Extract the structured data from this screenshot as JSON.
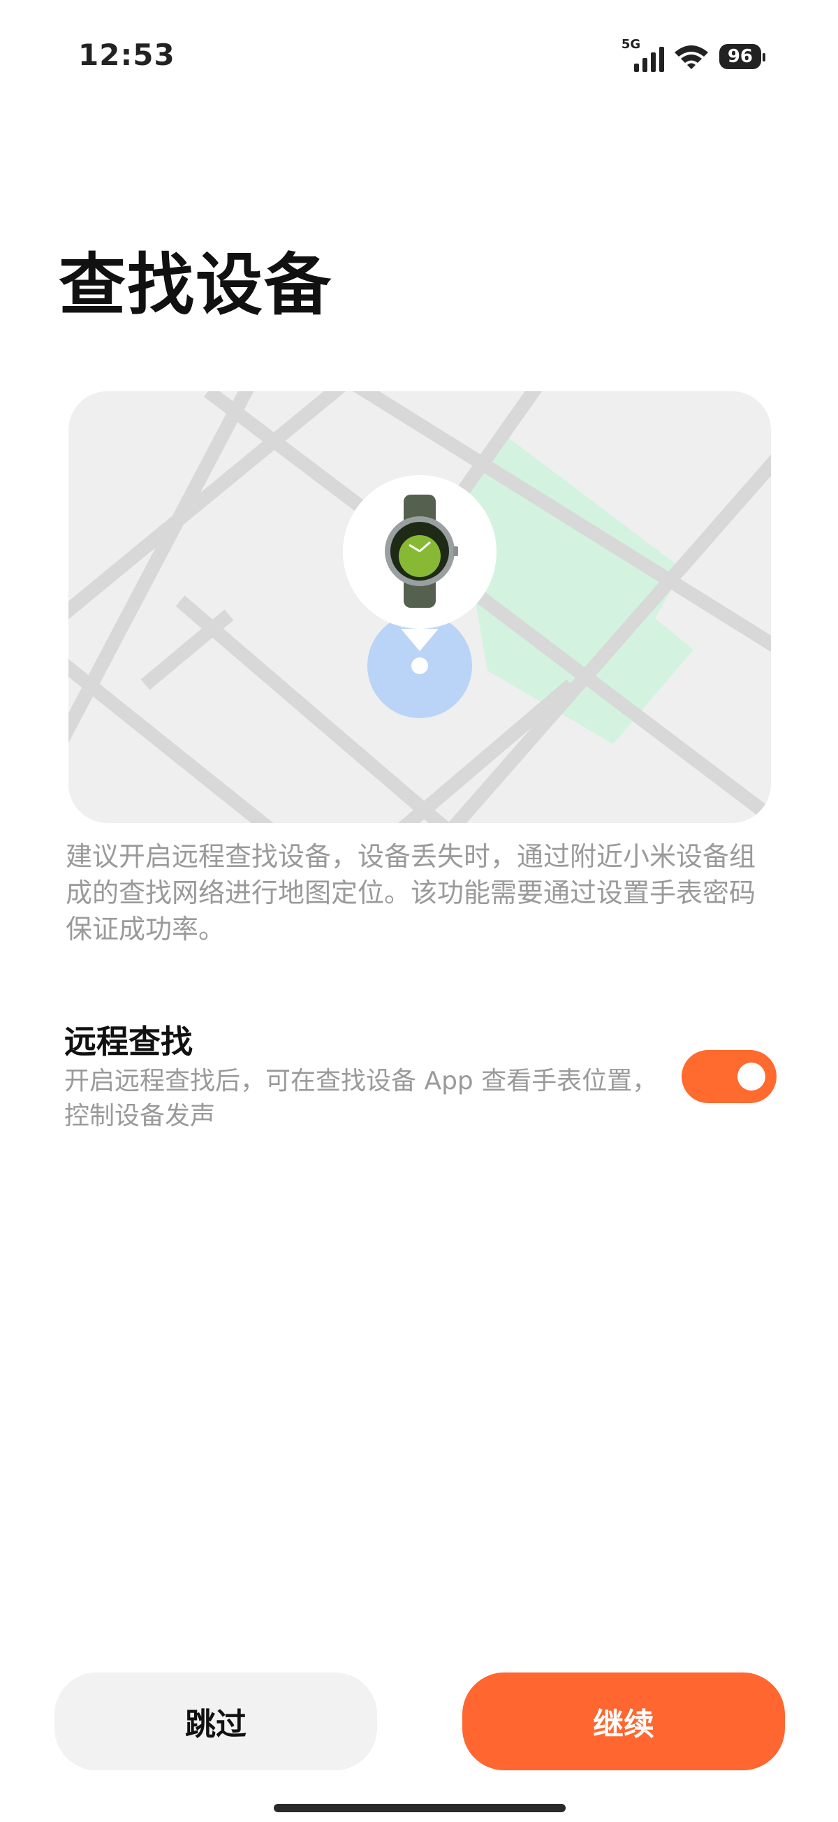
{
  "status_bar": {
    "time": "12:53",
    "network_label": "5G",
    "battery_level": "96",
    "icons": [
      "signal-icon",
      "wifi-icon",
      "battery-icon"
    ]
  },
  "page": {
    "title": "查找设备"
  },
  "map": {
    "illustration": "map-with-watch-location-pin",
    "device_icon": "smartwatch-icon",
    "location_dot_color": "#b9d4f7",
    "park_color": "#d3f3e0"
  },
  "description": "建议开启远程查找设备，设备丢失时，通过附近小米设备组成的查找网络进行地图定位。该功能需要通过设置手表密码保证成功率。",
  "remote_find": {
    "title": "远程查找",
    "subtitle": "开启远程查找后，可在查找设备 App 查看手表位置，控制设备发声",
    "enabled": true,
    "toggle_color": "#ff6a2e"
  },
  "buttons": {
    "skip_label": "跳过",
    "continue_label": "继续",
    "continue_color": "#ff6630"
  }
}
